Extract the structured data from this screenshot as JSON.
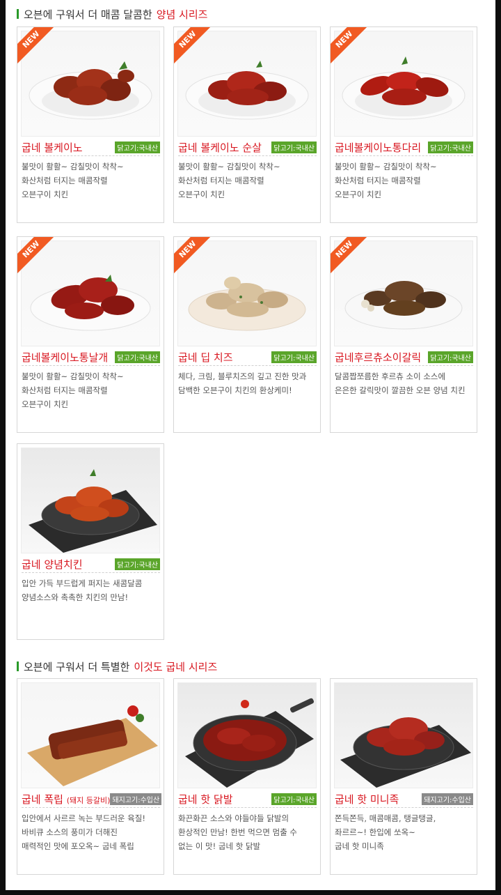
{
  "section1": {
    "prefix": "오븐에 구워서 더 매콤 달콤한",
    "highlight": "양념 시리즈"
  },
  "section2": {
    "prefix": "오븐에 구워서 더 특별한",
    "highlight": "이것도 굽네 시리즈"
  },
  "new_label": "NEW",
  "colors": {
    "accent_red": "#d8161f",
    "origin_green": "#5aa52a",
    "new_orange": "#f15a22"
  },
  "products": [
    {
      "name": "굽네 볼케이노",
      "badge": "닭고기:국내산",
      "new": true,
      "desc": [
        "불맛이 활활~ 감칠맛이 착착~",
        "화산처럼 터지는 매콤작렬",
        "오븐구이 치킨"
      ]
    },
    {
      "name": "굽네 볼케이노 순살",
      "badge": "닭고기:국내산",
      "new": true,
      "desc": [
        "불맛이 활활~ 감칠맛이 착착~",
        "화산처럼 터지는 매콤작렬",
        "오븐구이 치킨"
      ]
    },
    {
      "name": "굽네볼케이노통다리",
      "badge": "닭고기:국내산",
      "new": true,
      "desc": [
        "불맛이 활활~ 감칠맛이 착착~",
        "화산처럼 터지는 매콤작렬",
        "오븐구이 치킨"
      ]
    },
    {
      "name": "굽네볼케이노통날개",
      "badge": "닭고기:국내산",
      "new": true,
      "desc": [
        "불맛이 활활~ 감칠맛이 착착~",
        "화산처럼 터지는 매콤작렬",
        "오븐구이 치킨"
      ]
    },
    {
      "name": "굽네 딥 치즈",
      "badge": "닭고기:국내산",
      "new": true,
      "desc": [
        "체다, 크림, 블루치즈의 깊고 진한 맛과",
        "담백한 오븐구이 치킨의 환상케미!"
      ]
    },
    {
      "name": "굽네후르츄소이갈릭",
      "badge": "닭고기:국내산",
      "new": true,
      "desc": [
        "달콤짭쪼름한 후르츄 소이 소스에",
        "은은한 갈릭맛이 깔끔한 오븐 양념 치킨"
      ]
    },
    {
      "name": "굽네 양념치킨",
      "badge": "닭고기:국내산",
      "new": false,
      "desc": [
        "입안 가득 부드럽게 퍼지는 새콤달콤",
        "양념소스와 촉촉한 치킨의 만남!"
      ]
    },
    {
      "name": "굽네 폭립",
      "name_suffix": "(돼지 등갈비)",
      "badge": "돼지고기:수입산",
      "new": false,
      "desc": [
        "입안에서 사르르 녹는 부드러운 육질!",
        "바비큐 소스의 풍미가 더해진",
        "매력적인 맛에 포오옥~ 굽네 폭립"
      ]
    },
    {
      "name": "굽네 핫 닭발",
      "badge": "닭고기:국내산",
      "new": false,
      "desc": [
        "화끈화끈 소스와 야들야들 닭발의",
        "환상적인 만남! 한번 먹으면 멈출 수",
        "없는 이 맛! 굽네 핫 닭발"
      ]
    },
    {
      "name": "굽네 핫 미니족",
      "badge": "돼지고기:수입산",
      "new": false,
      "desc": [
        "쫀득쫀득, 매콤매콤, 탱글탱글,",
        "좌르르~! 한입에 쏘옥~",
        "굽네 핫 미니족"
      ]
    }
  ]
}
